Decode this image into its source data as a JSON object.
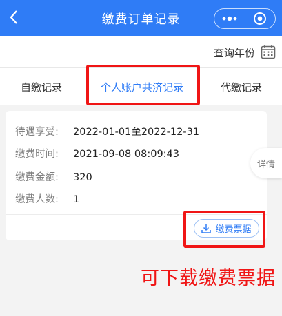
{
  "header": {
    "title": "缴费订单记录",
    "back_icon": "chevron-left-icon",
    "more_icon": "more-dots-icon",
    "close_icon": "target-circle-icon",
    "background_color": "#2f7cf6"
  },
  "year_query": {
    "label": "查询年份",
    "icon": "calendar-icon"
  },
  "tabs": [
    {
      "label": "自缴记录",
      "active": false
    },
    {
      "label": "个人账户共济记录",
      "active": true
    },
    {
      "label": "代缴记录",
      "active": false
    }
  ],
  "record": {
    "rows": [
      {
        "key": "待遇享受:",
        "value": "2022-01-01至2022-12-31"
      },
      {
        "key": "缴费时间:",
        "value": "2021-09-08 08:09:43"
      },
      {
        "key": "缴费金额:",
        "value": "320"
      },
      {
        "key": "缴费人数:",
        "value": "1"
      }
    ],
    "receipt_button": "缴费票据",
    "receipt_icon": "download-icon"
  },
  "detail_float": "详情",
  "annotation": "可下载缴费票据",
  "colors": {
    "accent": "#2f7cf6",
    "highlight": "#f01515"
  }
}
